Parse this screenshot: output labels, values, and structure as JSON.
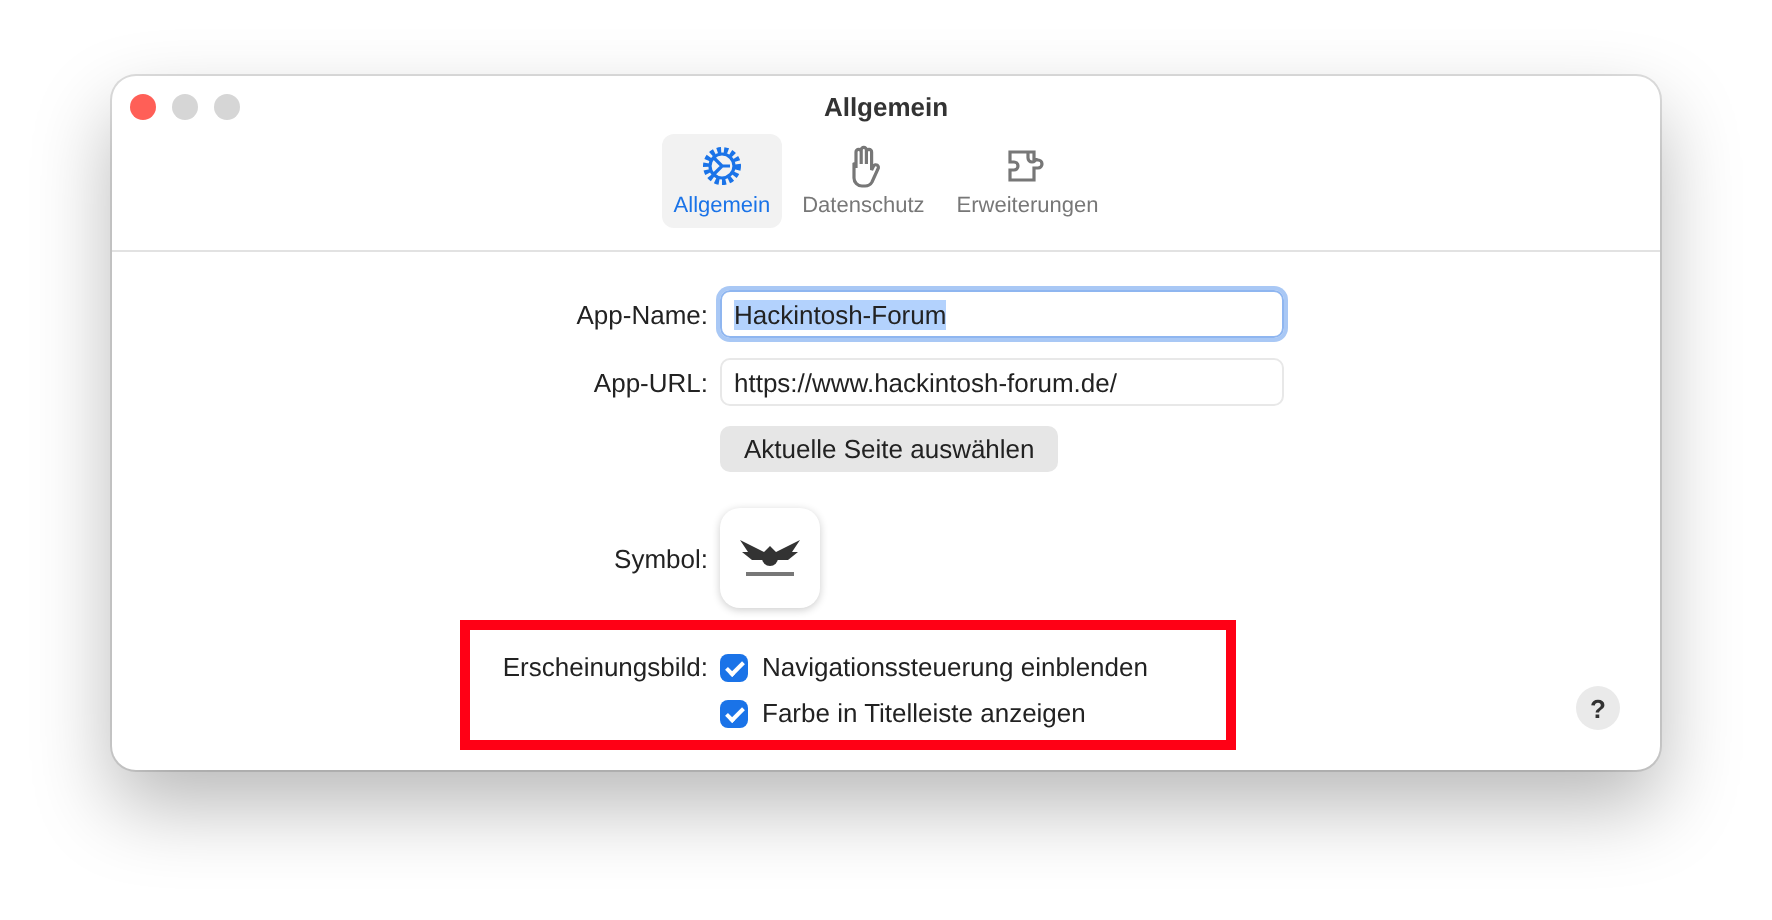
{
  "window": {
    "title": "Allgemein"
  },
  "tabs": [
    {
      "label": "Allgemein",
      "selected": true
    },
    {
      "label": "Datenschutz",
      "selected": false
    },
    {
      "label": "Erweiterungen",
      "selected": false
    }
  ],
  "form": {
    "app_name": {
      "label": "App-Name:",
      "value": "Hackintosh-Forum",
      "focused": true
    },
    "app_url": {
      "label": "App-URL:",
      "value": "https://www.hackintosh-forum.de/"
    },
    "pick_button": "Aktuelle Seite auswählen",
    "symbol": {
      "label": "Symbol:"
    },
    "appearance": {
      "label": "Erscheinungsbild:",
      "options": [
        {
          "label": "Navigationssteuerung einblenden",
          "checked": true
        },
        {
          "label": "Farbe in Titelleiste anzeigen",
          "checked": true
        }
      ]
    }
  },
  "help_button": "?"
}
